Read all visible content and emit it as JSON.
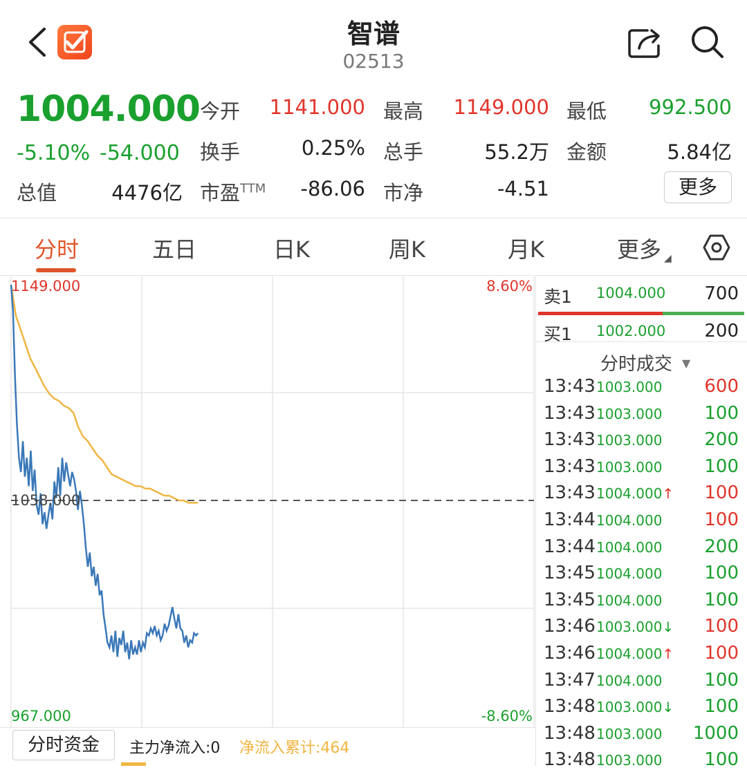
{
  "header": {
    "title": "智谱",
    "code": "02513"
  },
  "quote": {
    "price": "1004.000",
    "change_pct": "-5.10%",
    "change_abs": "-54.000",
    "stats": [
      {
        "label": "今开",
        "value": "1141.000",
        "color": "red"
      },
      {
        "label": "最高",
        "value": "1149.000",
        "color": "red"
      },
      {
        "label": "最低",
        "value": "992.500",
        "color": "green"
      },
      {
        "label": "换手",
        "value": "0.25%",
        "color": "black"
      },
      {
        "label": "总手",
        "value": "55.2万",
        "color": "black"
      },
      {
        "label": "金额",
        "value": "5.84亿",
        "color": "black"
      },
      {
        "label": "总值",
        "value": "4476亿",
        "color": "black"
      },
      {
        "label": "市盈TTM",
        "value": "-86.06",
        "color": "black"
      },
      {
        "label": "市净",
        "value": "-4.51",
        "color": "black"
      }
    ],
    "more_label": "更多"
  },
  "tabs": [
    "分时",
    "五日",
    "日K",
    "周K",
    "月K",
    "更多"
  ],
  "active_tab": "分时",
  "chart": {
    "high_label": "1149.000",
    "low_label": "967.000",
    "prev_close_label": "1058.000",
    "up_pct": "8.60%",
    "down_pct": "-8.60%"
  },
  "chart_data": {
    "type": "line",
    "ylim": [
      967.0,
      1149.0
    ],
    "prev_close": 1058.0,
    "x_range": [
      0,
      330
    ],
    "series": [
      {
        "values": [
          1149,
          1138,
          1110,
          1090,
          1076,
          1070,
          1083,
          1068,
          1076,
          1064,
          1079,
          1062,
          1071,
          1056,
          1052,
          1061,
          1048,
          1053,
          1046,
          1052,
          1057,
          1050,
          1066,
          1059,
          1072,
          1060,
          1076,
          1066,
          1074,
          1069,
          1064,
          1070,
          1067,
          1062,
          1054,
          1062,
          1056,
          1048,
          1038,
          1030,
          1036,
          1026,
          1030,
          1022,
          1027,
          1018,
          1020,
          1010,
          1004,
          998,
          996,
          1001,
          994,
          1003,
          992,
          1000,
          997,
          1003,
          994,
          998,
          991,
          999,
          993,
          996,
          993,
          999,
          994,
          998,
          996,
          1002,
          1001,
          1004,
          1002,
          1005,
          1001,
          1003,
          999,
          1001,
          1006,
          1003,
          1005,
          1009,
          1013,
          1008,
          1004,
          1010,
          1004,
          1003,
          998,
          1001,
          996,
          999,
          998,
          1002,
          1001,
          1002
        ]
      },
      {
        "values": [
          1149,
          1136,
          1130,
          1124,
          1118,
          1114,
          1110,
          1106,
          1103,
          1101,
          1100,
          1098,
          1097,
          1095,
          1089,
          1085,
          1083,
          1080,
          1077,
          1075,
          1072,
          1069,
          1068,
          1067,
          1066,
          1065,
          1064,
          1064,
          1063,
          1063,
          1062,
          1061,
          1060,
          1060,
          1059,
          1058,
          1058,
          1057,
          1057,
          1057
        ]
      }
    ]
  },
  "orderbook": {
    "ask": {
      "label": "卖1",
      "price": "1004.000",
      "vol": "700"
    },
    "bid": {
      "label": "买1",
      "price": "1002.000",
      "vol": "200"
    }
  },
  "trades_title": "分时成交",
  "trades": [
    {
      "time": "13:43",
      "price": "1003.000",
      "vol": "600",
      "dir": "",
      "vol_color": "red"
    },
    {
      "time": "13:43",
      "price": "1003.000",
      "vol": "100",
      "dir": "",
      "vol_color": "green"
    },
    {
      "time": "13:43",
      "price": "1003.000",
      "vol": "200",
      "dir": "",
      "vol_color": "green"
    },
    {
      "time": "13:43",
      "price": "1003.000",
      "vol": "100",
      "dir": "",
      "vol_color": "green"
    },
    {
      "time": "13:43",
      "price": "1004.000",
      "vol": "100",
      "dir": "↑",
      "vol_color": "red"
    },
    {
      "time": "13:44",
      "price": "1004.000",
      "vol": "100",
      "dir": "",
      "vol_color": "red"
    },
    {
      "time": "13:44",
      "price": "1004.000",
      "vol": "200",
      "dir": "",
      "vol_color": "green"
    },
    {
      "time": "13:45",
      "price": "1004.000",
      "vol": "100",
      "dir": "",
      "vol_color": "green"
    },
    {
      "time": "13:45",
      "price": "1004.000",
      "vol": "100",
      "dir": "",
      "vol_color": "green"
    },
    {
      "time": "13:46",
      "price": "1003.000",
      "vol": "100",
      "dir": "↓",
      "vol_color": "red"
    },
    {
      "time": "13:46",
      "price": "1004.000",
      "vol": "100",
      "dir": "↑",
      "vol_color": "red"
    },
    {
      "time": "13:47",
      "price": "1004.000",
      "vol": "100",
      "dir": "",
      "vol_color": "green"
    },
    {
      "time": "13:48",
      "price": "1003.000",
      "vol": "100",
      "dir": "↓",
      "vol_color": "green"
    },
    {
      "time": "13:48",
      "price": "1003.000",
      "vol": "1000",
      "dir": "",
      "vol_color": "green"
    },
    {
      "time": "13:48",
      "price": "1003.000",
      "vol": "100",
      "dir": "",
      "vol_color": "green"
    }
  ],
  "fund_flow": {
    "button": "分时资金",
    "main_inflow": "主力净流入:0",
    "cumulative": "净流入累计:464"
  },
  "colors": {
    "red": "#e0352b",
    "green": "#1aa02e",
    "price_line": "#3a78b8",
    "avg_line": "#f0b541",
    "accent": "#e0552b"
  }
}
